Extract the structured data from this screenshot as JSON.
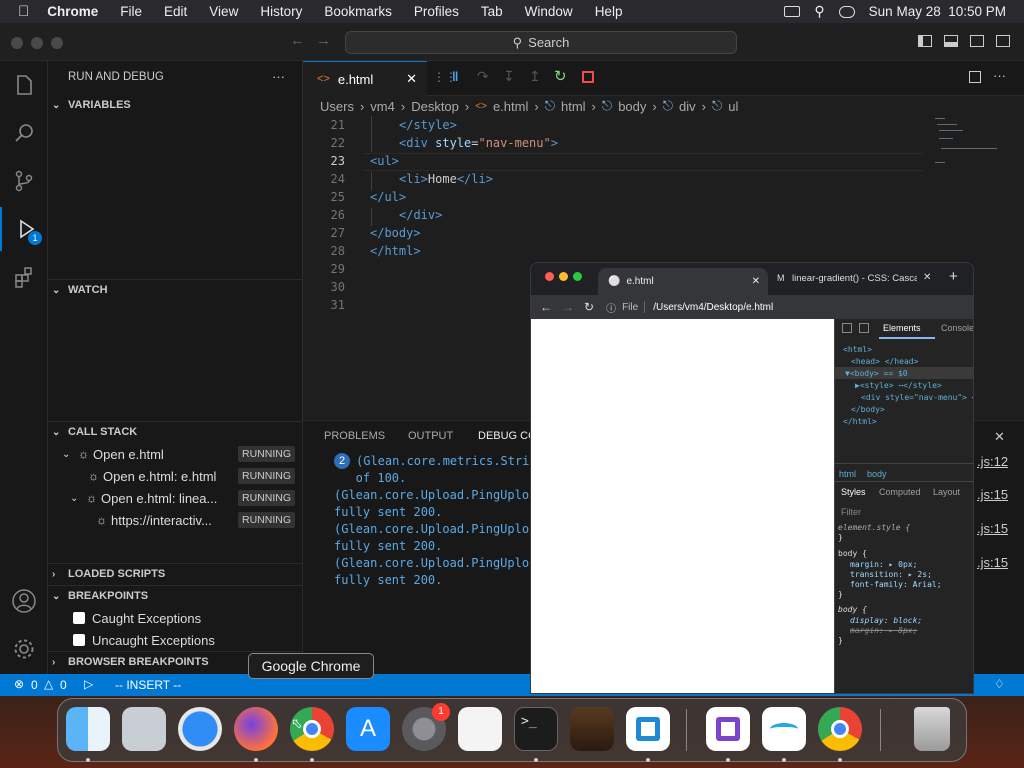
{
  "menubar": {
    "app": "Chrome",
    "items": [
      "File",
      "Edit",
      "View",
      "History",
      "Bookmarks",
      "Profiles",
      "Tab",
      "Window",
      "Help"
    ],
    "datetime": "Sun May 28  10:50 PM"
  },
  "titlebar": {
    "search_label": "Search"
  },
  "activity": {
    "debug_badge": "1"
  },
  "sidebar": {
    "title": "RUN AND DEBUG",
    "more": "···",
    "variables": "VARIABLES",
    "watch": "WATCH",
    "call_stack": "CALL STACK",
    "call_stack_items": [
      {
        "label": "Open e.html",
        "status": "RUNNING"
      },
      {
        "label": "Open e.html: e.html",
        "status": "RUNNING"
      },
      {
        "label": "Open e.html: linea...",
        "status": "RUNNING"
      },
      {
        "label": "https://interactiv...",
        "status": "RUNNING"
      }
    ],
    "loaded_scripts": "LOADED SCRIPTS",
    "breakpoints": "BREAKPOINTS",
    "caught": "Caught Exceptions",
    "uncaught": "Uncaught Exceptions",
    "browser_breakpoints": "BROWSER BREAKPOINTS"
  },
  "editor": {
    "tab_label": "e.html",
    "breadcrumb": [
      "Users",
      "vm4",
      "Desktop",
      "e.html",
      "html",
      "body",
      "div",
      "ul"
    ],
    "line_numbers": [
      "21",
      "22",
      "23",
      "24",
      "25",
      "26",
      "27",
      "28",
      "29",
      "30",
      "31"
    ],
    "lines": {
      "l21": "</style>",
      "l22a": "<div ",
      "l22b": "style",
      "l22c": "=",
      "l22d": "\"nav-menu\"",
      "l22e": ">",
      "l23": "<ul>",
      "l24a": "<li>",
      "l24b": "Home",
      "l24c": "</li>",
      "l25": "</ul>",
      "l26": "</div>",
      "l27": "</body>",
      "l28": "</html>"
    }
  },
  "panel": {
    "tabs": [
      "PROBLEMS",
      "OUTPUT",
      "DEBUG CO"
    ],
    "count_badge": "2",
    "lines": [
      "(Glean.core.metrics.Stri",
      "   of 100.",
      "(Glean.core.Upload.PingUplo",
      "fully sent 200.",
      "(Glean.core.Upload.PingUplo",
      "fully sent 200.",
      "(Glean.core.Upload.PingUplo",
      "fully sent 200."
    ],
    "right_refs": [
      ".js:12",
      ".js:15",
      ".js:15",
      ".js:15"
    ]
  },
  "statusbar": {
    "errors": "0",
    "warnings": "0",
    "mode": "-- INSERT --"
  },
  "chrome": {
    "tab1": "e.html",
    "tab2": "linear-gradient() - CSS: Cascad",
    "address_prefix": "File",
    "address": "/Users/vm4/Desktop/e.html",
    "devtools": {
      "tab_elements": "Elements",
      "tab_console": "Console",
      "dom": [
        "<html>",
        "<head> </head>",
        "▼<body> == $0",
        "▶<style> ⋯</style>",
        "<div style=\"nav-menu\"> <",
        "</body>",
        "</html>"
      ],
      "crumbs": [
        "html",
        "body"
      ],
      "style_tabs": [
        "Styles",
        "Computed",
        "Layout"
      ],
      "filter": "Filter",
      "rules": [
        "element.style {",
        "}",
        "body {",
        "margin: ▸ 0px;",
        "transition: ▸ 2s;",
        "font-family: Arial;",
        "}",
        "body {",
        "display: block;",
        "margin: ▸ 8px;",
        "}"
      ]
    }
  },
  "tooltip": "Google Chrome",
  "dock": {
    "items": [
      "Finder",
      "Launchpad",
      "Safari",
      "Firefox",
      "Google Chrome",
      "App Store",
      "System Settings",
      "TextEdit",
      "Terminal",
      "GarageBand",
      "Visual Studio Code",
      "Visual Studio",
      "Freeform",
      "Google Chrome",
      "Trash"
    ],
    "settings_badge": "1"
  },
  "colors": {
    "accent": "#0078d4",
    "panel_text": "#5aa9e6"
  }
}
